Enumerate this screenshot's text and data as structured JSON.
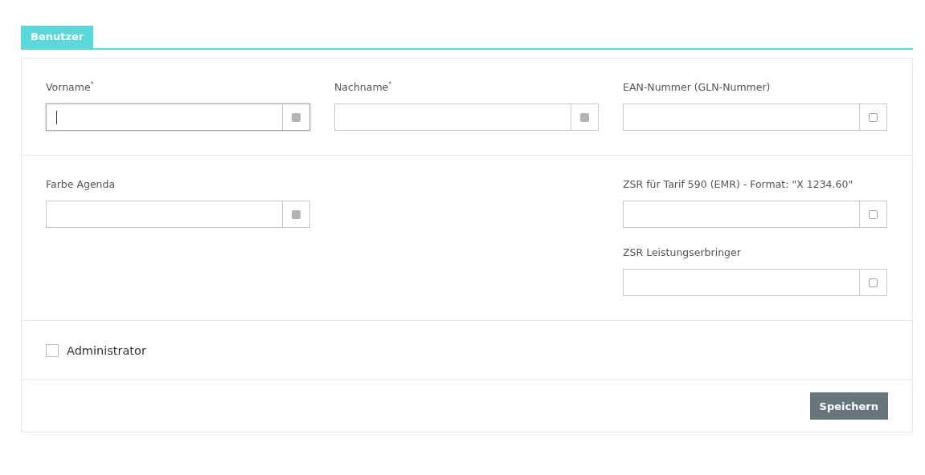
{
  "tabs": [
    {
      "label": "Benutzer",
      "selected": true
    }
  ],
  "sections": [
    {
      "kind": "thirds",
      "columns": [
        {
          "fields": [
            {
              "label": "Vorname$^{*}$",
              "kind": "filled",
              "focused": true
            }
          ]
        },
        {
          "fields": [
            {
              "label": "Nachname$^{*}$",
              "kind": "filled",
              "focused": false
            }
          ]
        },
        {
          "fields": [
            {
              "label": "EAN-Nummer (GLN-Nummer)",
              "kind": "hollow",
              "focused": false
            }
          ]
        }
      ]
    },
    {
      "kind": "split",
      "columns": [
        {
          "fields": [
            {
              "label": "Farbe Agenda",
              "kind": "filled",
              "focused": false
            }
          ]
        },
        {
          "fields": [
            {
              "label": "ZSR für Tarif 590 (EMR) - Format: \"X 1234.60\"",
              "kind": "hollow",
              "focused": false
            },
            {
              "label": "ZSR Leistungserbringer",
              "kind": "hollow",
              "focused": false
            }
          ]
        }
      ]
    }
  ],
  "checkbox": {
    "label": "Administrator",
    "checked": false
  },
  "buttons": [
    {
      "label": "Speichern"
    }
  ]
}
